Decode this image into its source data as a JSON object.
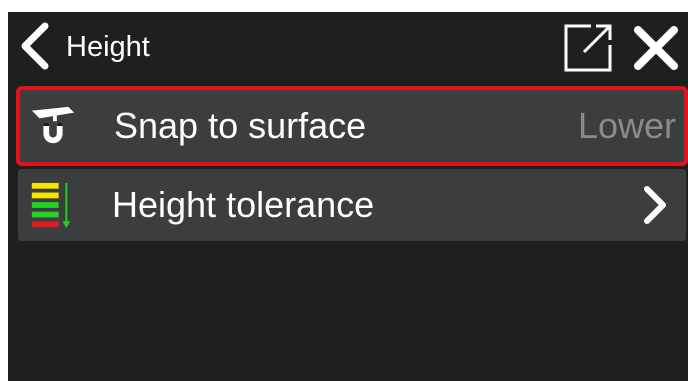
{
  "header": {
    "title": "Height",
    "back_icon": "chevron-left-icon",
    "popout_icon": "external-window-icon",
    "close_icon": "close-icon"
  },
  "items": [
    {
      "label": "Snap to surface",
      "value": "Lower",
      "icon": "snap-magnet-icon",
      "selected": true
    },
    {
      "label": "Height tolerance",
      "icon": "tolerance-bars-icon",
      "chevron_icon": "chevron-right-icon"
    }
  ],
  "colors": {
    "background": "#1e1f21",
    "row": "#3c3d3f",
    "selection_border": "#e0141e",
    "text": "#ffffff",
    "value_text": "#8a8b8d",
    "tolerance_yellow": "#f2e600",
    "tolerance_green": "#22d422",
    "tolerance_red": "#e01e1e"
  }
}
